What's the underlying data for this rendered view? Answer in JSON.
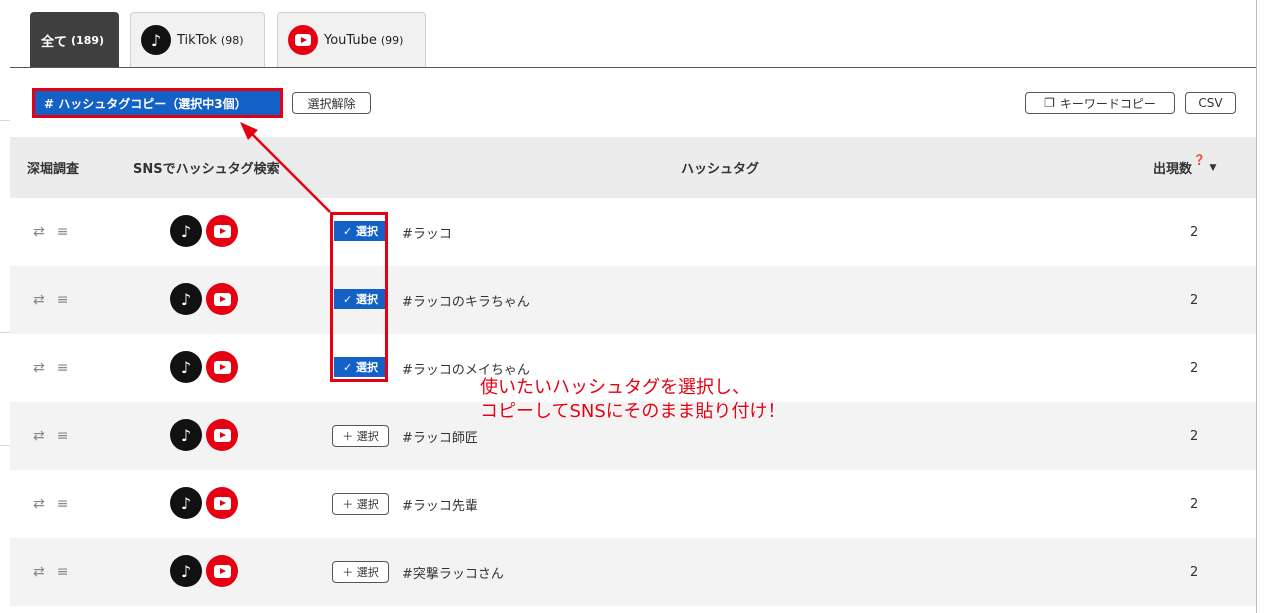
{
  "tabs": [
    {
      "label": "全て",
      "count": "(189)",
      "active": true
    },
    {
      "label": "TikTok",
      "count": "(98)",
      "icon": "tiktok-icon"
    },
    {
      "label": "YouTube",
      "count": "(99)",
      "icon": "youtube-icon"
    }
  ],
  "toolbar": {
    "hashtag_copy": "# ハッシュタグコピー（選択中3個）",
    "clear_selection": "選択解除",
    "keyword_copy": "キーワードコピー",
    "csv": "CSV"
  },
  "table": {
    "headers": {
      "deep": "深堀調査",
      "sns_search": "SNSでハッシュタグ検索",
      "hashtag": "ハッシュタグ",
      "count": "出現数"
    },
    "rows": [
      {
        "tag": "#ラッコ",
        "count": "2",
        "selected": true
      },
      {
        "tag": "#ラッコのキラちゃん",
        "count": "2",
        "selected": true
      },
      {
        "tag": "#ラッコのメイちゃん",
        "count": "2",
        "selected": true
      },
      {
        "tag": "#ラッコ師匠",
        "count": "2",
        "selected": false
      },
      {
        "tag": "#ラッコ先輩",
        "count": "2",
        "selected": false
      },
      {
        "tag": "#突撃ラッコさん",
        "count": "2",
        "selected": false
      }
    ],
    "select_label_on": "✓ 選択",
    "select_label_off": "＋ 選択"
  },
  "annotation": {
    "line1": "使いたいハッシュタグを選択し、",
    "line2": "コピーしてSNSにそのまま貼り付け！"
  },
  "colors": {
    "accent": "#1360c7",
    "highlight": "#e50012",
    "youtube": "#e60012",
    "tiktok": "#111111"
  }
}
